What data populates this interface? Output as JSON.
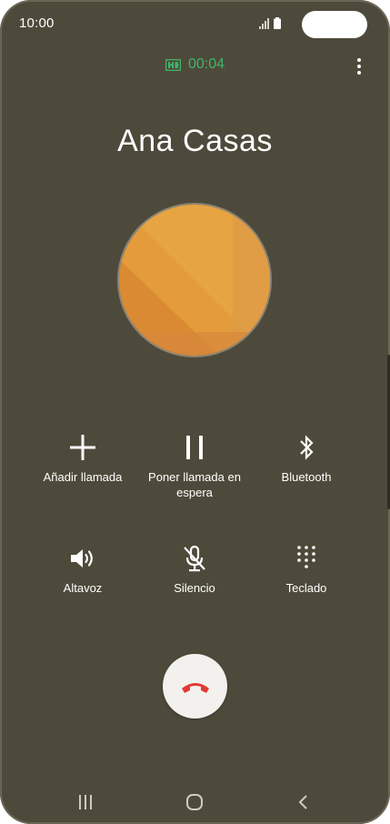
{
  "status_bar": {
    "time": "10:00",
    "icons": [
      "signal-icon",
      "battery-icon"
    ]
  },
  "call": {
    "timer": "00:04",
    "contact_name": "Ana Casas",
    "hd_icon": "hd-voice-icon",
    "timer_color": "#3fb56b"
  },
  "actions": [
    {
      "label": "Añadir llamada",
      "icon": "add-icon"
    },
    {
      "label": "Poner llamada en espera",
      "icon": "pause-icon"
    },
    {
      "label": "Bluetooth",
      "icon": "bluetooth-icon"
    },
    {
      "label": "Altavoz",
      "icon": "speaker-icon"
    },
    {
      "label": "Silencio",
      "icon": "mic-off-icon"
    },
    {
      "label": "Teclado",
      "icon": "keypad-icon"
    }
  ],
  "end_call": {
    "icon": "end-call-icon",
    "color": "#e53935"
  },
  "nav": [
    "recent-apps-icon",
    "home-icon",
    "back-icon"
  ],
  "colors": {
    "background": "#4e4a3b",
    "avatar_orange": "#e39b3c"
  }
}
